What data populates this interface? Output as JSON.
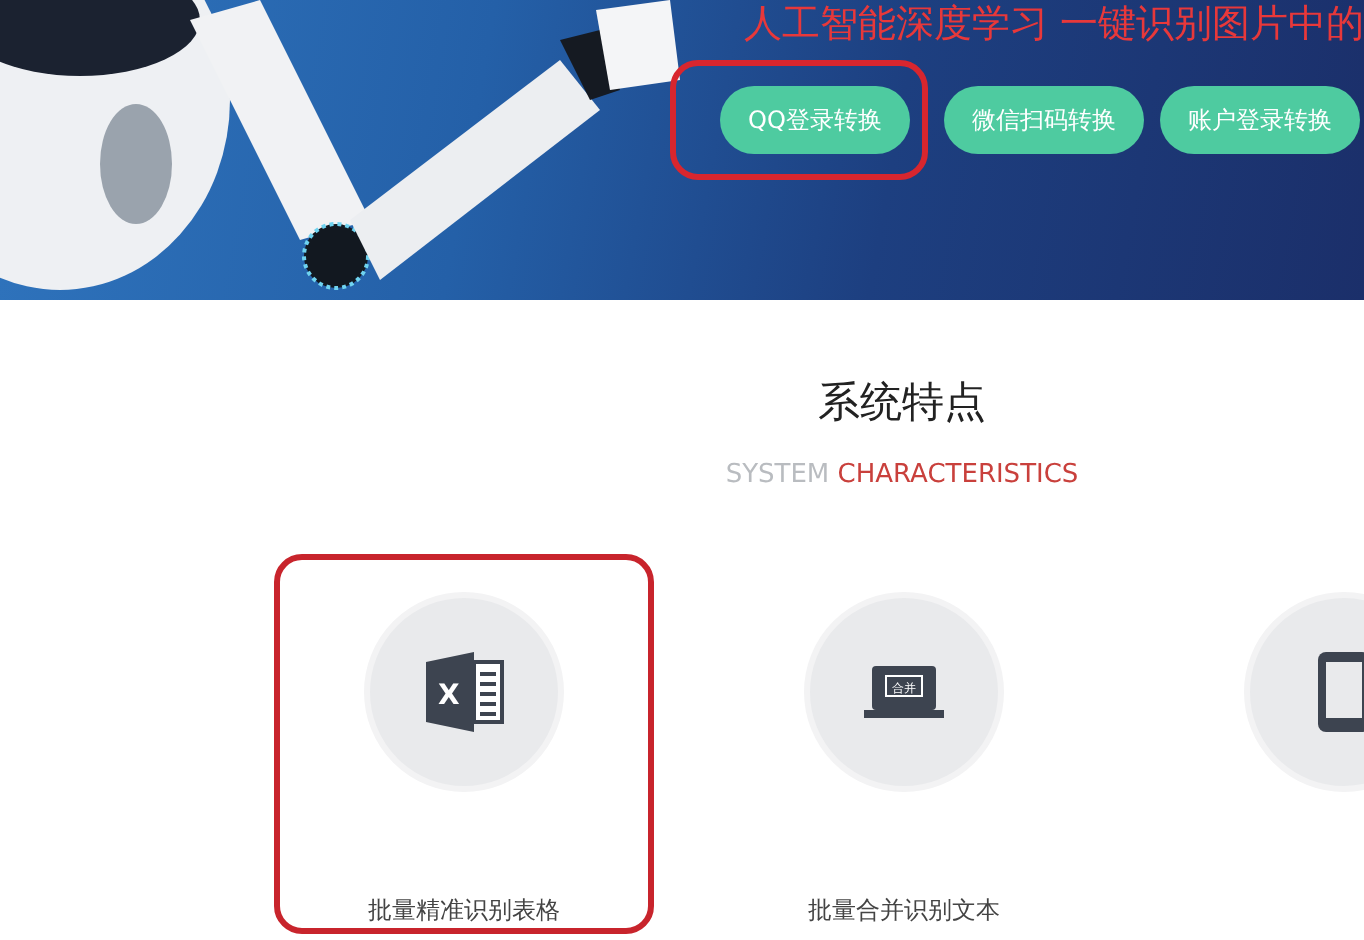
{
  "banner": {
    "headline": "人工智能深度学习 一键识别图片中的",
    "buttons": [
      {
        "label": "QQ登录转换",
        "highlighted": true
      },
      {
        "label": "微信扫码转换",
        "highlighted": false
      },
      {
        "label": "账户登录转换",
        "highlighted": false
      }
    ]
  },
  "section": {
    "title": "系统特点",
    "subtitle_muted": "SYSTEM",
    "subtitle_accent": "CHARACTERISTICS"
  },
  "features": [
    {
      "kind": "spreadsheet",
      "icon_text": "X",
      "label": "批量精准识别表格",
      "highlighted": true
    },
    {
      "kind": "laptop",
      "icon_text": "合并",
      "label": "批量合并识别文本",
      "highlighted": false
    },
    {
      "kind": "phone",
      "highlighted": false
    }
  ]
}
